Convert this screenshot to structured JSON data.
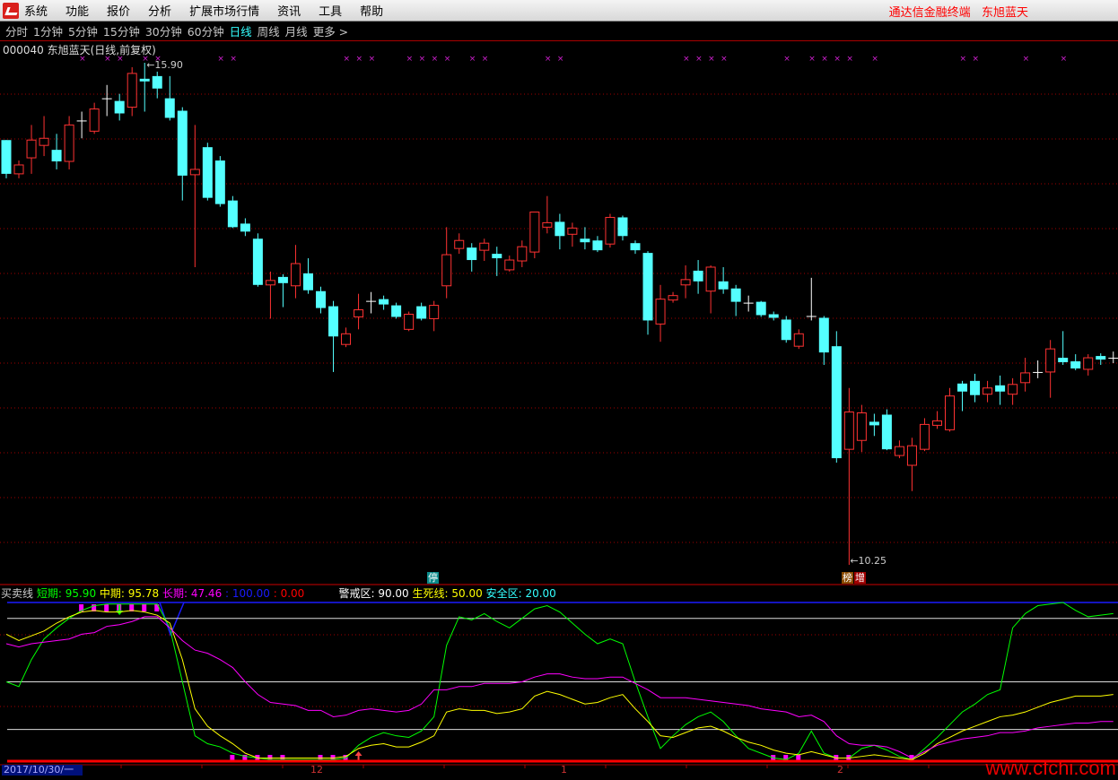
{
  "menubar": {
    "items": [
      "系统",
      "功能",
      "报价",
      "分析",
      "扩展市场行情",
      "资讯",
      "工具",
      "帮助"
    ],
    "brand": "通达信金融终端   东旭蓝天"
  },
  "toolbar": {
    "periods": [
      "分时",
      "1分钟",
      "5分钟",
      "15分钟",
      "30分钟",
      "60分钟",
      "日线",
      "周线",
      "月线",
      "更多 >"
    ],
    "active": "日线"
  },
  "stock": {
    "title": "000040 东旭蓝天(日线,前复权)"
  },
  "price_labels": {
    "high": "15.90",
    "low": "10.25"
  },
  "tags": {
    "stop": "停",
    "bang": "榜",
    "zeng": "增"
  },
  "indicator": {
    "name": "买卖线",
    "short_label": "短期:",
    "short_value": "95.90",
    "mid_label": "中期:",
    "mid_value": "95.78",
    "long_label": "长期:",
    "long_value": "47.46",
    "v100": ": 100.00",
    "v0": ": 0.00",
    "warn_label": "警戒区:",
    "warn_value": "90.00",
    "life_label": "生死线:",
    "life_value": "50.00",
    "safe_label": "安全区:",
    "safe_value": "20.00"
  },
  "axis": {
    "date": "2017/10/30/一",
    "months": [
      "12",
      "1",
      "2"
    ]
  },
  "watermark": "www.cfchi.com",
  "colors": {
    "up": "#ff3232",
    "down": "#54ffff",
    "flat": "#ffffff",
    "short": "#00ff00",
    "mid": "#ffff00",
    "long": "#ff00ff",
    "grid": "#a00000"
  },
  "chart_data": {
    "type": "candlestick",
    "title": "000040 东旭蓝天(日线,前复权)",
    "ylim": [
      10.25,
      15.9
    ],
    "candles": [
      [
        15.03,
        14.65,
        15.03,
        14.6
      ],
      [
        14.65,
        14.75,
        14.8,
        14.6
      ],
      [
        14.83,
        15.03,
        15.2,
        14.65
      ],
      [
        14.97,
        15.05,
        15.3,
        14.85
      ],
      [
        14.92,
        14.79,
        15.1,
        14.7
      ],
      [
        14.79,
        15.2,
        15.3,
        14.7
      ],
      [
        15.25,
        15.25,
        15.35,
        15.05
      ],
      [
        15.13,
        15.38,
        15.45,
        15.1
      ],
      [
        15.5,
        15.5,
        15.65,
        15.3
      ],
      [
        15.47,
        15.33,
        15.55,
        15.25
      ],
      [
        15.4,
        15.78,
        15.85,
        15.3
      ],
      [
        15.72,
        15.69,
        15.9,
        15.35
      ],
      [
        15.75,
        15.61,
        15.8,
        15.5
      ],
      [
        15.5,
        15.28,
        15.75,
        15.25
      ],
      [
        15.36,
        14.63,
        15.4,
        14.35
      ],
      [
        14.64,
        14.7,
        15.2,
        13.6
      ],
      [
        14.95,
        14.38,
        15.0,
        14.35
      ],
      [
        14.8,
        14.31,
        14.85,
        14.28
      ],
      [
        14.35,
        14.05,
        14.4,
        14.04
      ],
      [
        14.09,
        14.0,
        14.15,
        13.95
      ],
      [
        13.92,
        13.4,
        13.98,
        13.38
      ],
      [
        13.4,
        13.45,
        13.55,
        13.02
      ],
      [
        13.49,
        13.42,
        13.52,
        13.15
      ],
      [
        13.39,
        13.64,
        13.85,
        13.25
      ],
      [
        13.53,
        13.34,
        13.7,
        13.3
      ],
      [
        13.33,
        13.14,
        13.38,
        13.08
      ],
      [
        13.16,
        12.82,
        13.22,
        12.42
      ],
      [
        12.73,
        12.85,
        12.92,
        12.7
      ],
      [
        13.04,
        13.12,
        13.3,
        12.9
      ],
      [
        13.22,
        13.22,
        13.32,
        13.08
      ],
      [
        13.24,
        13.18,
        13.28,
        13.12
      ],
      [
        13.17,
        13.04,
        13.2,
        13.02
      ],
      [
        12.9,
        13.07,
        13.1,
        12.88
      ],
      [
        13.16,
        13.02,
        13.2,
        13.0
      ],
      [
        13.02,
        13.17,
        13.22,
        12.88
      ],
      [
        13.39,
        13.74,
        14.05,
        13.25
      ],
      [
        13.81,
        13.9,
        13.98,
        13.75
      ],
      [
        13.82,
        13.68,
        13.87,
        13.55
      ],
      [
        13.79,
        13.87,
        13.92,
        13.67
      ],
      [
        13.75,
        13.7,
        13.83,
        13.5
      ],
      [
        13.57,
        13.68,
        13.73,
        13.55
      ],
      [
        13.67,
        13.83,
        13.9,
        13.6
      ],
      [
        13.77,
        14.22,
        14.22,
        13.7
      ],
      [
        14.05,
        14.1,
        14.4,
        13.98
      ],
      [
        14.11,
        13.95,
        14.2,
        13.8
      ],
      [
        13.97,
        14.04,
        14.1,
        13.83
      ],
      [
        13.92,
        13.88,
        14.05,
        13.8
      ],
      [
        13.9,
        13.79,
        13.95,
        13.77
      ],
      [
        13.86,
        14.16,
        14.2,
        13.82
      ],
      [
        14.16,
        13.95,
        14.18,
        13.9
      ],
      [
        13.87,
        13.79,
        13.9,
        13.75
      ],
      [
        13.76,
        13.0,
        13.78,
        12.84
      ],
      [
        12.96,
        13.24,
        13.4,
        12.76
      ],
      [
        13.23,
        13.28,
        13.32,
        13.2
      ],
      [
        13.4,
        13.46,
        13.62,
        13.25
      ],
      [
        13.56,
        13.44,
        13.68,
        13.3
      ],
      [
        13.33,
        13.6,
        13.62,
        13.08
      ],
      [
        13.44,
        13.35,
        13.6,
        13.3
      ],
      [
        13.36,
        13.21,
        13.4,
        13.05
      ],
      [
        13.2,
        13.2,
        13.28,
        13.1
      ],
      [
        13.21,
        13.06,
        13.22,
        13.04
      ],
      [
        13.07,
        13.03,
        13.1,
        13.0
      ],
      [
        13.01,
        12.78,
        13.05,
        12.75
      ],
      [
        12.71,
        12.85,
        12.9,
        12.68
      ],
      [
        13.05,
        13.05,
        13.48,
        13.0
      ],
      [
        13.03,
        12.64,
        13.05,
        12.5
      ],
      [
        12.71,
        11.45,
        12.88,
        11.4
      ],
      [
        11.55,
        11.97,
        12.24,
        10.25
      ],
      [
        11.65,
        11.96,
        12.05,
        11.52
      ],
      [
        11.86,
        11.82,
        11.95,
        11.7
      ],
      [
        11.94,
        11.55,
        12.0,
        11.54
      ],
      [
        11.48,
        11.58,
        11.65,
        11.45
      ],
      [
        11.37,
        11.59,
        11.68,
        11.08
      ],
      [
        11.55,
        11.83,
        11.9,
        11.53
      ],
      [
        11.82,
        11.87,
        11.98,
        11.78
      ],
      [
        11.77,
        12.15,
        12.24,
        11.75
      ],
      [
        12.29,
        12.2,
        12.32,
        11.98
      ],
      [
        12.32,
        12.16,
        12.4,
        12.08
      ],
      [
        12.17,
        12.24,
        12.32,
        12.08
      ],
      [
        12.27,
        12.2,
        12.38,
        12.05
      ],
      [
        12.17,
        12.28,
        12.35,
        12.05
      ],
      [
        12.3,
        12.41,
        12.58,
        12.2
      ],
      [
        12.42,
        12.42,
        12.55,
        12.35
      ],
      [
        12.42,
        12.68,
        12.78,
        12.13
      ],
      [
        12.58,
        12.53,
        12.88,
        12.5
      ],
      [
        12.54,
        12.46,
        12.62,
        12.44
      ],
      [
        12.45,
        12.58,
        12.62,
        12.38
      ],
      [
        12.6,
        12.56,
        12.63,
        12.5
      ],
      [
        12.58,
        12.58,
        12.65,
        12.52
      ]
    ],
    "indicator": {
      "ylim": [
        0,
        100
      ],
      "levels": [
        100,
        90,
        50,
        20,
        0
      ],
      "series": [
        {
          "name": "短期",
          "values": [
            50,
            47,
            64,
            77,
            84,
            90,
            95,
            98,
            99,
            99,
            99,
            99,
            99,
            84,
            50,
            16,
            11,
            9,
            5,
            3,
            2,
            1,
            1,
            1,
            1,
            1,
            1,
            2,
            10,
            15,
            18,
            16,
            15,
            19,
            28,
            73,
            91,
            89,
            93,
            88,
            84,
            90,
            96,
            98,
            94,
            87,
            80,
            74,
            77,
            74,
            50,
            28,
            8,
            16,
            23,
            28,
            31,
            25,
            16,
            8,
            5,
            2,
            1,
            5,
            19,
            5,
            2,
            2,
            8,
            10,
            7,
            3,
            1,
            8,
            15,
            23,
            31,
            36,
            42,
            45,
            84,
            93,
            98,
            99,
            100,
            95,
            91,
            92,
            93
          ]
        },
        {
          "name": "中期",
          "values": [
            80,
            76,
            79,
            82,
            87,
            91,
            94,
            95,
            94,
            94,
            95,
            94,
            92,
            87,
            64,
            33,
            22,
            16,
            11,
            5,
            2,
            2,
            2,
            2,
            2,
            2,
            2,
            3,
            8,
            10,
            11,
            9,
            9,
            12,
            16,
            31,
            33,
            32,
            32,
            30,
            31,
            33,
            41,
            44,
            42,
            39,
            36,
            37,
            40,
            42,
            33,
            25,
            16,
            15,
            18,
            21,
            22,
            19,
            15,
            12,
            10,
            7,
            5,
            4,
            6,
            4,
            2,
            2,
            3,
            4,
            3,
            2,
            1,
            5,
            11,
            15,
            19,
            22,
            25,
            28,
            29,
            31,
            34,
            37,
            39,
            41,
            41,
            41,
            42
          ]
        },
        {
          "name": "长期",
          "values": [
            74,
            72,
            74,
            75,
            76,
            77,
            80,
            81,
            85,
            86,
            88,
            91,
            91,
            84,
            76,
            70,
            68,
            64,
            59,
            50,
            42,
            37,
            36,
            35,
            32,
            32,
            28,
            29,
            32,
            33,
            32,
            31,
            32,
            36,
            45,
            45,
            47,
            47,
            49,
            49,
            49,
            50,
            53,
            55,
            55,
            53,
            52,
            52,
            53,
            53,
            49,
            45,
            40,
            40,
            40,
            39,
            38,
            37,
            36,
            35,
            33,
            32,
            31,
            28,
            29,
            25,
            16,
            11,
            10,
            10,
            9,
            6,
            2,
            6,
            10,
            12,
            14,
            15,
            16,
            18,
            18,
            19,
            21,
            22,
            23,
            24,
            24,
            25,
            25
          ]
        }
      ],
      "top_markers": [
        6,
        7,
        8,
        9,
        10,
        11,
        12
      ],
      "bottom_markers": [
        18,
        19,
        20,
        21,
        22,
        25,
        26,
        27,
        61,
        62,
        63,
        66,
        67,
        72
      ],
      "buy_arrow": 28,
      "sell_arrow": 9
    },
    "cross_marks": [
      6,
      8,
      9,
      11,
      12,
      17,
      18,
      27,
      28,
      29,
      32,
      33,
      34,
      35,
      37,
      38,
      43,
      44,
      54,
      55,
      56,
      57,
      62,
      64,
      65,
      66,
      67,
      69,
      76,
      77,
      81,
      84
    ]
  }
}
